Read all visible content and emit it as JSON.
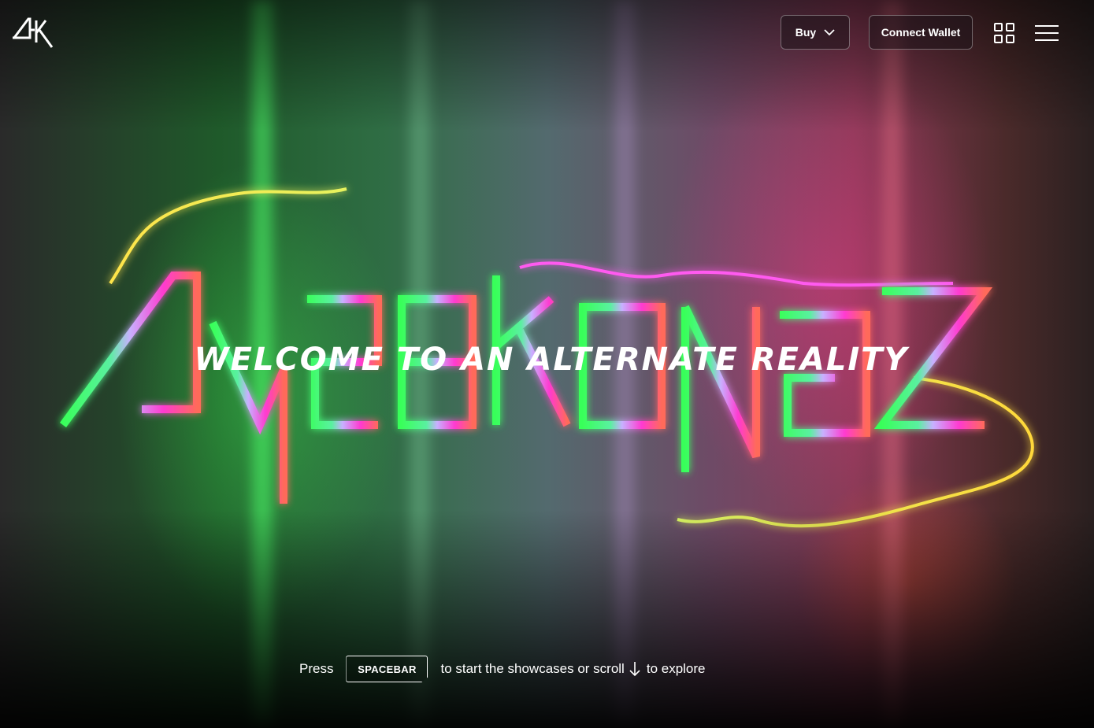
{
  "header": {
    "logo_text": "4K",
    "buy_label": "Buy",
    "connect_wallet_label": "Connect Wallet"
  },
  "hero": {
    "title_art_text": "CYBERKONGZ",
    "tagline": "WELCOME TO AN ALTERNATE REALITY"
  },
  "footer_hint": {
    "press": "Press",
    "key": "SPACEBAR",
    "middle": "to start the showcases or scroll",
    "end": "to explore"
  },
  "icons": {
    "chevron": "chevron-down-icon",
    "grid": "grid-icon",
    "menu": "hamburger-menu-icon",
    "arrow": "arrow-down-icon"
  },
  "colors": {
    "green_glow": "#39ff5a",
    "pink_glow": "#ff3ad0",
    "yellow_glow": "#ffe44a",
    "text": "#ffffff"
  }
}
